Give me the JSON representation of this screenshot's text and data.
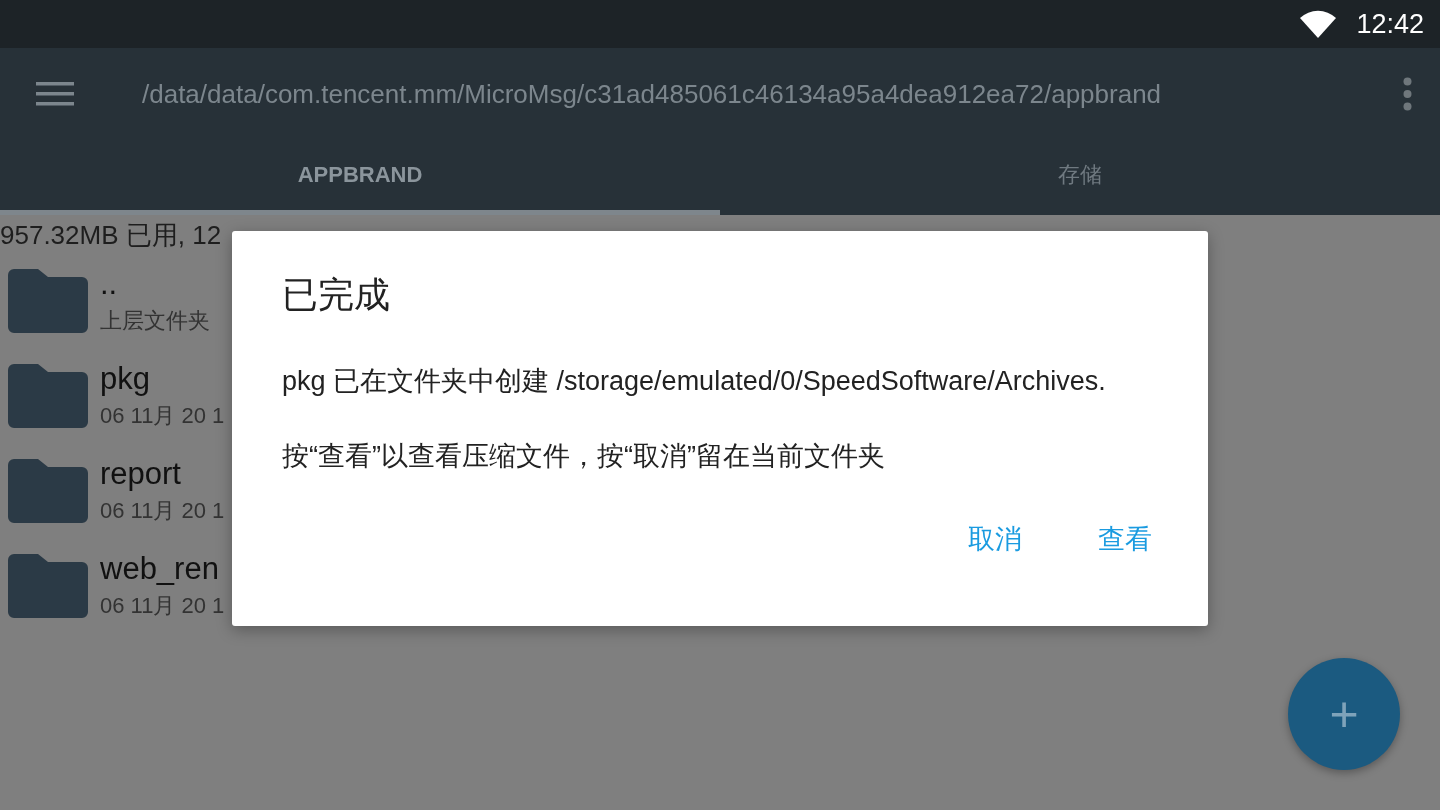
{
  "status_bar": {
    "time": "12:42"
  },
  "app_bar": {
    "path": "/data/data/com.tencent.mm/MicroMsg/c31ad485061c46134a95a4dea912ea72/appbrand"
  },
  "tabs": [
    {
      "label": "APPBRAND",
      "selected": true
    },
    {
      "label": "存储",
      "selected": false
    }
  ],
  "storage_summary": "957.32MB 已用, 12",
  "files": [
    {
      "name": "..",
      "detail": "上层文件夹"
    },
    {
      "name": "pkg",
      "detail": "06 11月 20 1"
    },
    {
      "name": "report",
      "detail": "06 11月 20 1"
    },
    {
      "name": "web_ren",
      "detail": "06 11月 20 1"
    }
  ],
  "dialog": {
    "title": "已完成",
    "message": "pkg 已在文件夹中创建 /storage/emulated/0/SpeedSoftware/Archives.",
    "hint": "按“查看”以查看压缩文件，按“取消”留在当前文件夹",
    "buttons": [
      "取消",
      "查看"
    ]
  },
  "fab": {
    "label": "+"
  }
}
